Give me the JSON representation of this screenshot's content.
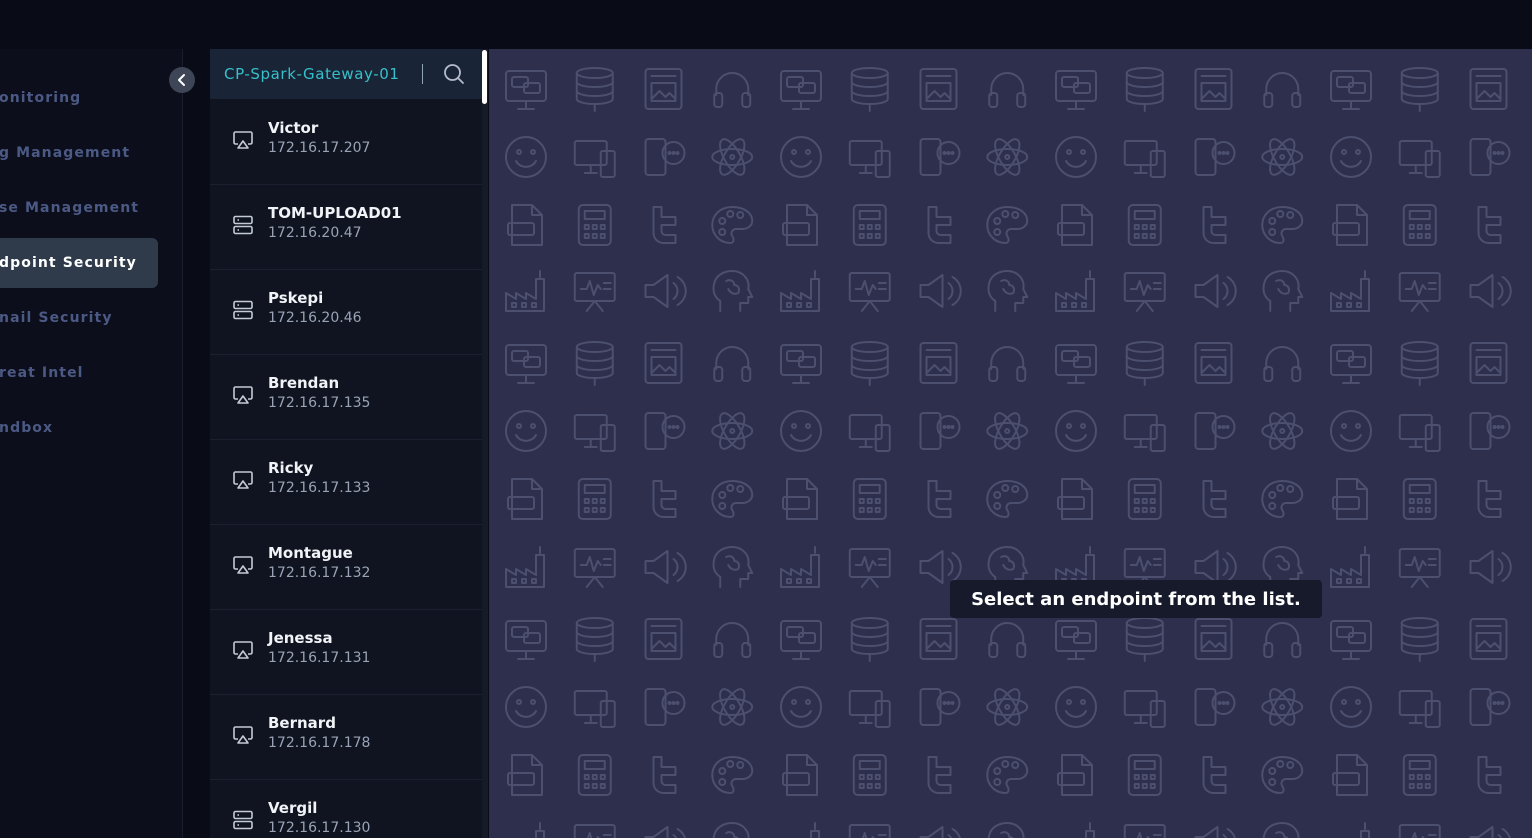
{
  "nav": {
    "items": [
      {
        "label": "Monitoring",
        "visible": "onitoring",
        "active": false
      },
      {
        "label": "Logging Management",
        "visible": "g Management",
        "active": false
      },
      {
        "label": "License Management",
        "visible": "se Management",
        "active": false
      },
      {
        "label": "Endpoint Security",
        "visible": "dpoint Security",
        "active": true
      },
      {
        "label": "Email Security",
        "visible": "nail Security",
        "active": false
      },
      {
        "label": "Threat Intel",
        "visible": "reat Intel",
        "active": false
      },
      {
        "label": "Sandbox",
        "visible": "ndbox",
        "active": false
      }
    ],
    "collapse_icon": "chevron-left-icon"
  },
  "search": {
    "value": "CP-Spark-Gateway-01",
    "icon": "search-icon"
  },
  "endpoints": [
    {
      "name": "Victor",
      "ip": "172.16.17.207",
      "icon": "airplay-icon"
    },
    {
      "name": "TOM-UPLOAD01",
      "ip": "172.16.20.47",
      "icon": "server-icon"
    },
    {
      "name": "Pskepi",
      "ip": "172.16.20.46",
      "icon": "server-icon"
    },
    {
      "name": "Brendan",
      "ip": "172.16.17.135",
      "icon": "airplay-icon"
    },
    {
      "name": "Ricky",
      "ip": "172.16.17.133",
      "icon": "airplay-icon"
    },
    {
      "name": "Montague",
      "ip": "172.16.17.132",
      "icon": "airplay-icon"
    },
    {
      "name": "Jenessa",
      "ip": "172.16.17.131",
      "icon": "airplay-icon"
    },
    {
      "name": "Bernard",
      "ip": "172.16.17.178",
      "icon": "airplay-icon"
    },
    {
      "name": "Vergil",
      "ip": "172.16.17.130",
      "icon": "server-icon"
    }
  ],
  "main": {
    "empty_message": "Select an endpoint from the list."
  },
  "colors": {
    "accent": "#35c1c9",
    "active_nav_bg": "#2f3b4b",
    "main_bg": "#2d2f4c"
  }
}
